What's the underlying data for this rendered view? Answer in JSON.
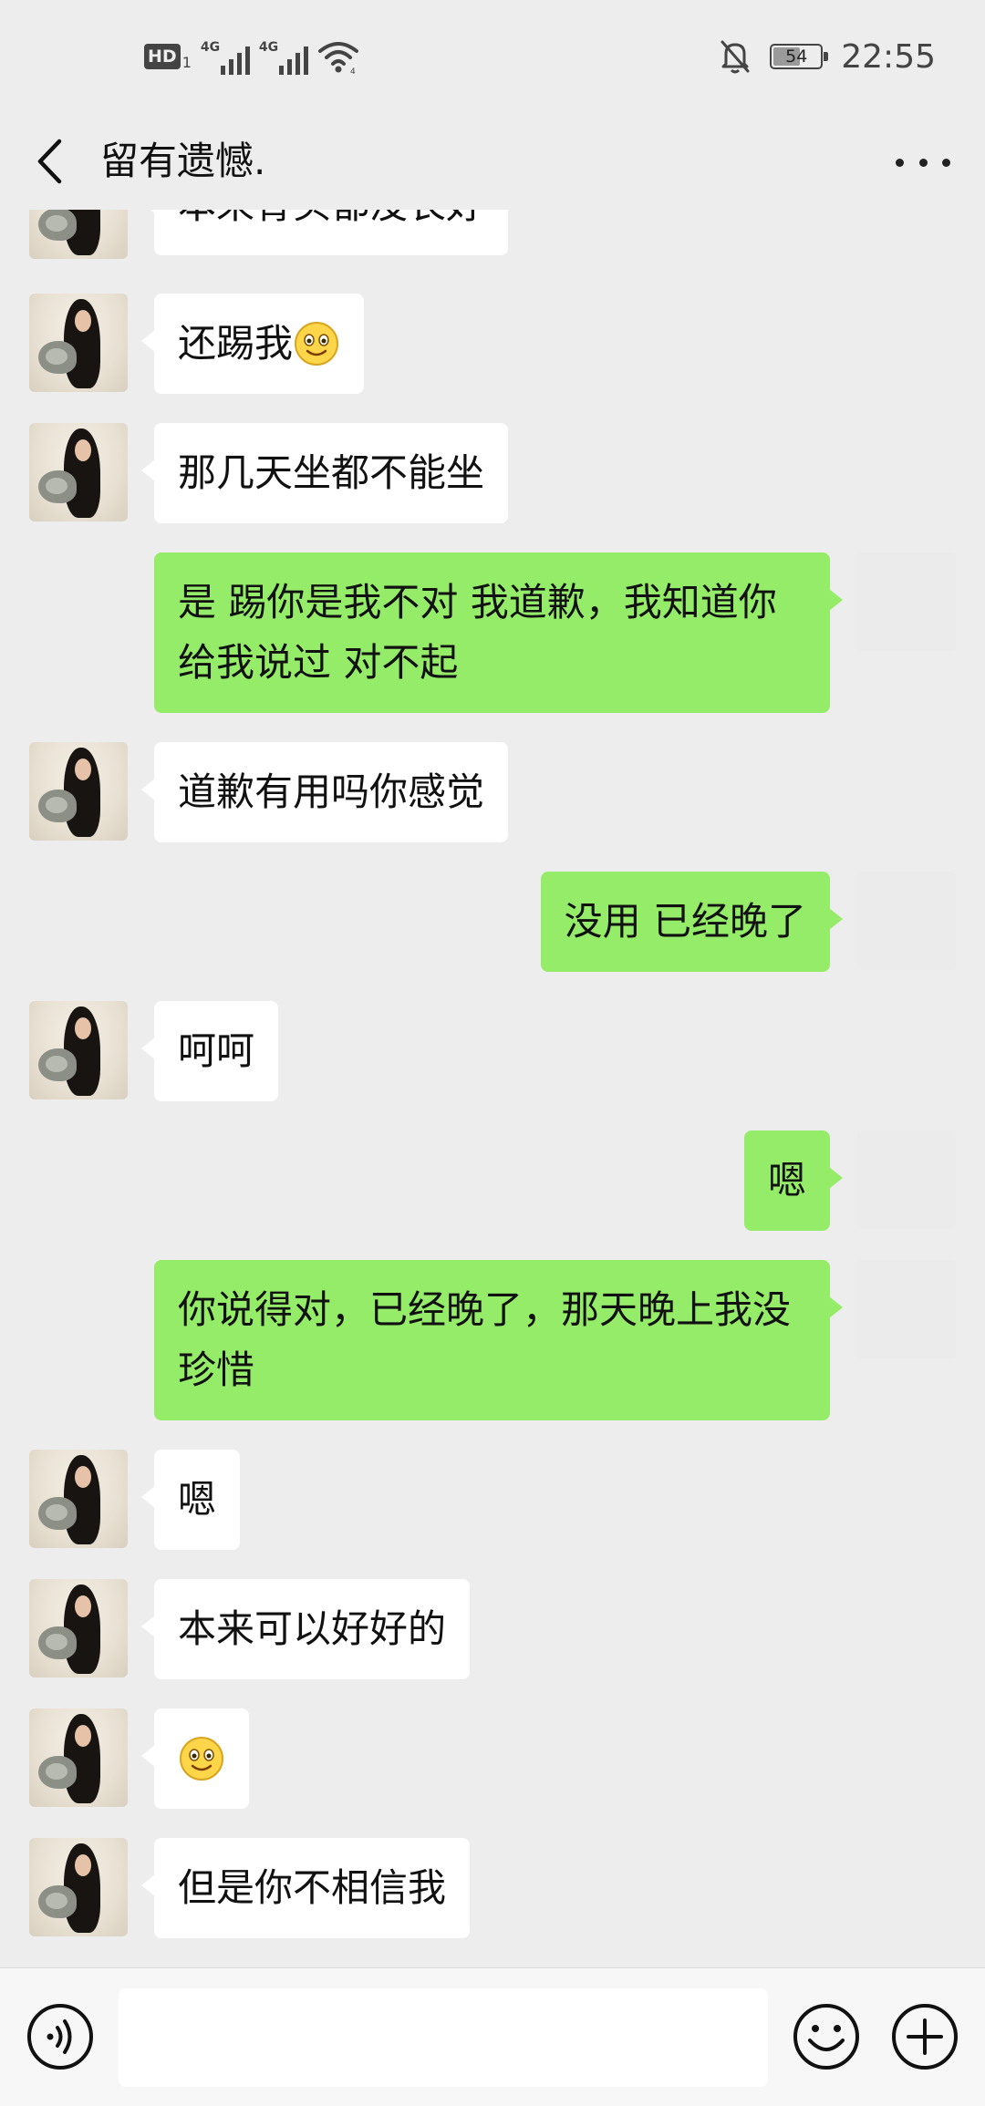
{
  "status_bar": {
    "hd_label": "HD",
    "hd_sub": "1",
    "signal1_label": "4G",
    "signal2_label": "4G",
    "battery_level": "54",
    "time": "22:55"
  },
  "header": {
    "title": "留有遗憾."
  },
  "messages": [
    {
      "side": "in",
      "text": "本来骨头都没长好"
    },
    {
      "side": "in",
      "text": "还踢我"
    },
    {
      "side": "in",
      "text": "那几天坐都不能坐"
    },
    {
      "side": "out",
      "text": "是  踢你是我不对  我道歉，我知道你给我说过  对不起"
    },
    {
      "side": "in",
      "text": "道歉有用吗你感觉"
    },
    {
      "side": "out",
      "text": "没用  已经晚了"
    },
    {
      "side": "in",
      "text": "呵呵"
    },
    {
      "side": "out",
      "text": "嗯"
    },
    {
      "side": "out",
      "text": "你说得对，已经晚了，那天晚上我没珍惜"
    },
    {
      "side": "in",
      "text": "嗯"
    },
    {
      "side": "in",
      "text": "本来可以好好的"
    },
    {
      "side": "in",
      "text": ""
    },
    {
      "side": "in",
      "text": "但是你不相信我"
    }
  ],
  "icons": {
    "back": "chevron-left-icon",
    "more": "more-dots-icon",
    "voice": "voice-icon",
    "emoji": "smile-emoji-icon",
    "plus": "plus-icon"
  },
  "colors": {
    "background": "#ededed",
    "outgoing_bubble": "#95ec69",
    "incoming_bubble": "#ffffff"
  }
}
